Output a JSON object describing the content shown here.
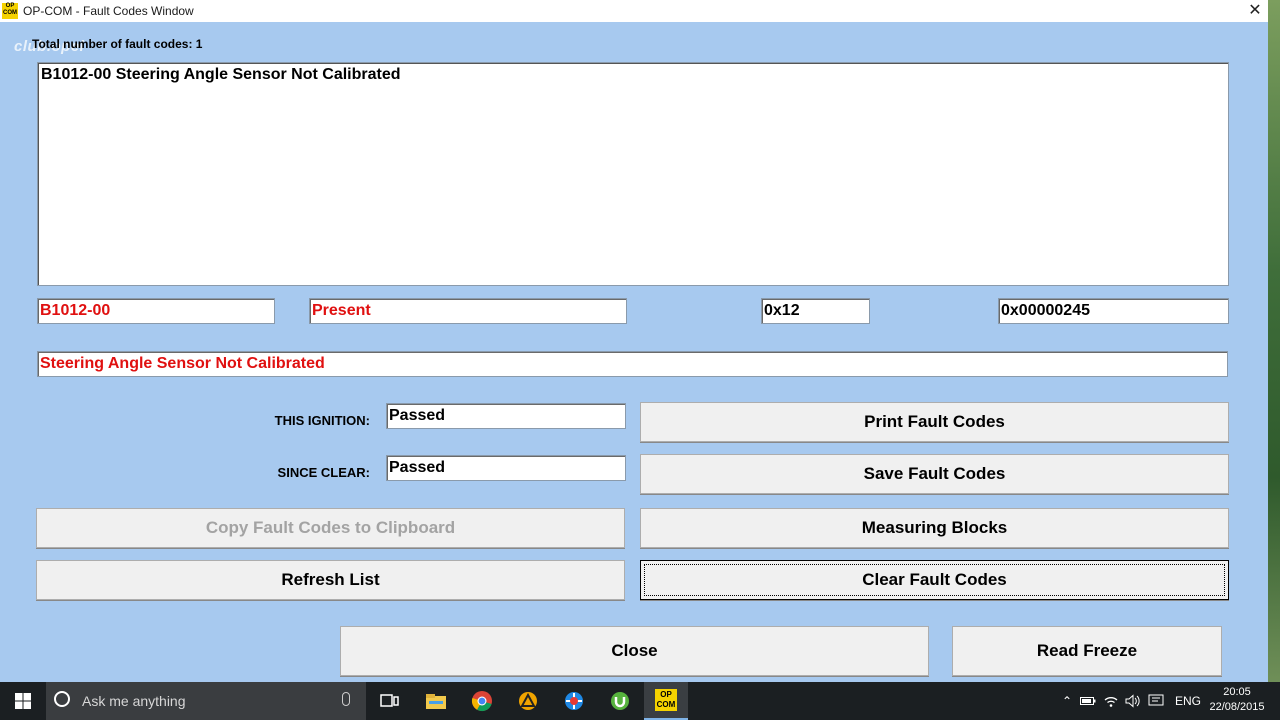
{
  "window": {
    "title": "OP-COM - Fault Codes Window",
    "app_icon_text": "OP COM",
    "close_glyph": "✕",
    "watermark": "club.opel"
  },
  "fault": {
    "total_label": "Total number of fault codes:",
    "total_count": "1",
    "list_items": [
      "B1012-00 Steering Angle Sensor Not Calibrated"
    ],
    "code": "B1012-00",
    "state": "Present",
    "hex_short": "0x12",
    "hex_long": "0x00000245",
    "description": "Steering Angle Sensor Not Calibrated"
  },
  "status": {
    "this_ignition_label": "THIS IGNITION:",
    "this_ignition_value": "Passed",
    "since_clear_label": "SINCE CLEAR:",
    "since_clear_value": "Passed"
  },
  "buttons": {
    "print": "Print Fault Codes",
    "save": "Save Fault Codes",
    "copy": "Copy Fault Codes to Clipboard",
    "measuring": "Measuring Blocks",
    "refresh": "Refresh List",
    "clear": "Clear Fault Codes",
    "close": "Close",
    "read_freeze": "Read Freeze"
  },
  "taskbar": {
    "search_placeholder": "Ask me anything",
    "opcom_label": "OP COM",
    "language": "ENG",
    "time": "20:05",
    "date": "22/08/2015",
    "icons": [
      "windows-start-icon",
      "cortana-circle-icon",
      "microphone-icon",
      "task-view-icon",
      "file-explorer-icon",
      "chrome-icon",
      "triangle-app-icon",
      "globe-app-icon",
      "utorrent-icon",
      "opcom-icon"
    ],
    "tray_icons": [
      "chevron-up-icon",
      "battery-icon",
      "wifi-icon",
      "volume-icon",
      "notifications-icon"
    ]
  },
  "colors": {
    "window_bg": "#a7c9ef",
    "red_text": "#e01010",
    "button_bg": "#f0f0f0",
    "taskbar_bg": "#1b1f22"
  }
}
